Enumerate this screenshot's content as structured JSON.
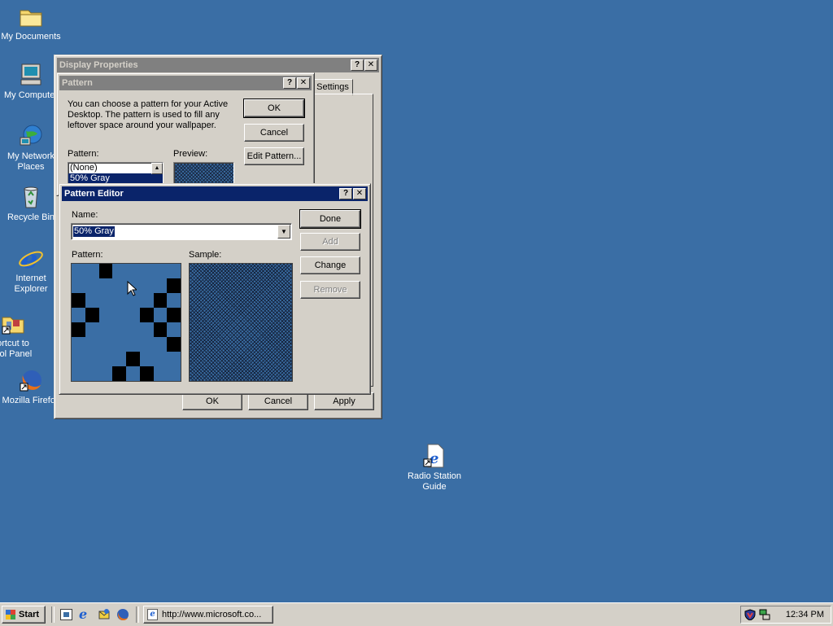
{
  "desktop": {
    "icons": [
      {
        "label": "My Documents"
      },
      {
        "label": "My Computer"
      },
      {
        "label": "My Network",
        "label2": "Places"
      },
      {
        "label": "Recycle Bin"
      },
      {
        "label": "Internet",
        "label2": "Explorer"
      },
      {
        "label": "ortcut to",
        "label2": "trol Panel"
      },
      {
        "label": "Mozilla Firefox"
      },
      {
        "label": "Radio Station",
        "label2": "Guide"
      }
    ]
  },
  "display_properties": {
    "title": "Display Properties",
    "tab_settings": "Settings",
    "ok": "OK",
    "cancel": "Cancel",
    "apply": "Apply"
  },
  "pattern_dialog": {
    "title": "Pattern",
    "description": "You can choose a pattern for your Active Desktop.  The pattern is used to fill any leftover space around your wallpaper.",
    "pattern_label": "Pattern:",
    "preview_label": "Preview:",
    "list": [
      "(None)",
      "50% Gray"
    ],
    "ok": "OK",
    "cancel": "Cancel",
    "edit_pattern": "Edit Pattern..."
  },
  "pattern_editor": {
    "title": "Pattern Editor",
    "name_label": "Name:",
    "name_value": "50% Gray",
    "pattern_label": "Pattern:",
    "sample_label": "Sample:",
    "done": "Done",
    "add": "Add",
    "change": "Change",
    "remove": "Remove",
    "grid": [
      [
        0,
        0,
        1,
        0,
        0,
        0,
        0,
        0
      ],
      [
        0,
        0,
        0,
        0,
        0,
        0,
        0,
        1
      ],
      [
        1,
        0,
        0,
        0,
        0,
        0,
        1,
        0
      ],
      [
        0,
        1,
        0,
        0,
        0,
        1,
        0,
        1
      ],
      [
        1,
        0,
        0,
        0,
        0,
        0,
        1,
        0
      ],
      [
        0,
        0,
        0,
        0,
        0,
        0,
        0,
        1
      ],
      [
        0,
        0,
        0,
        0,
        1,
        0,
        0,
        0
      ],
      [
        0,
        0,
        0,
        1,
        0,
        1,
        0,
        0
      ]
    ]
  },
  "taskbar": {
    "start": "Start",
    "task": "http://www.microsoft.co...",
    "clock": "12:34 PM"
  },
  "colors": {
    "desktop": "#3a6ea5",
    "title_active": "#0a246a",
    "title_inactive": "#808080",
    "face": "#d4d0c8"
  }
}
